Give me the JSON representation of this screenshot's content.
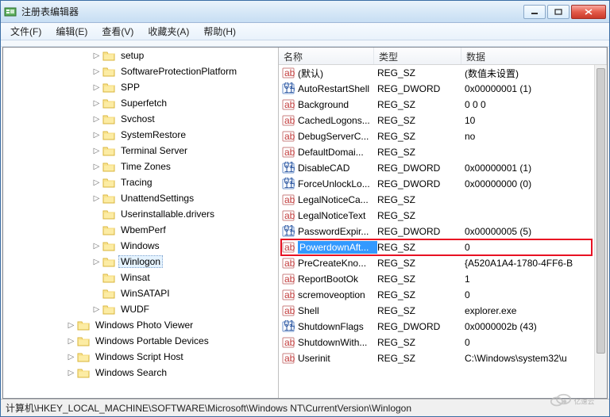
{
  "window": {
    "title": "注册表编辑器"
  },
  "menu": {
    "file": "文件(F)",
    "edit": "编辑(E)",
    "view": "查看(V)",
    "favorites": "收藏夹(A)",
    "help": "帮助(H)"
  },
  "columns": {
    "name": "名称",
    "type": "类型",
    "data": "数据"
  },
  "tree": [
    {
      "indent": 7,
      "label": "setup",
      "expand": "▷"
    },
    {
      "indent": 7,
      "label": "SoftwareProtectionPlatform",
      "expand": "▷"
    },
    {
      "indent": 7,
      "label": "SPP",
      "expand": "▷"
    },
    {
      "indent": 7,
      "label": "Superfetch",
      "expand": "▷"
    },
    {
      "indent": 7,
      "label": "Svchost",
      "expand": "▷"
    },
    {
      "indent": 7,
      "label": "SystemRestore",
      "expand": "▷"
    },
    {
      "indent": 7,
      "label": "Terminal Server",
      "expand": "▷"
    },
    {
      "indent": 7,
      "label": "Time Zones",
      "expand": "▷"
    },
    {
      "indent": 7,
      "label": "Tracing",
      "expand": "▷"
    },
    {
      "indent": 7,
      "label": "UnattendSettings",
      "expand": "▷"
    },
    {
      "indent": 7,
      "label": "Userinstallable.drivers",
      "expand": ""
    },
    {
      "indent": 7,
      "label": "WbemPerf",
      "expand": ""
    },
    {
      "indent": 7,
      "label": "Windows",
      "expand": "▷"
    },
    {
      "indent": 7,
      "label": "Winlogon",
      "expand": "▷",
      "selected": true
    },
    {
      "indent": 7,
      "label": "Winsat",
      "expand": ""
    },
    {
      "indent": 7,
      "label": "WinSATAPI",
      "expand": ""
    },
    {
      "indent": 7,
      "label": "WUDF",
      "expand": "▷"
    },
    {
      "indent": 5,
      "label": "Windows Photo Viewer",
      "expand": "▷"
    },
    {
      "indent": 5,
      "label": "Windows Portable Devices",
      "expand": "▷"
    },
    {
      "indent": 5,
      "label": "Windows Script Host",
      "expand": "▷"
    },
    {
      "indent": 5,
      "label": "Windows Search",
      "expand": "▷"
    }
  ],
  "values": [
    {
      "icon": "ab",
      "name": "(默认)",
      "type": "REG_SZ",
      "data": "(数值未设置)"
    },
    {
      "icon": "dw",
      "name": "AutoRestartShell",
      "type": "REG_DWORD",
      "data": "0x00000001 (1)"
    },
    {
      "icon": "ab",
      "name": "Background",
      "type": "REG_SZ",
      "data": "0 0 0"
    },
    {
      "icon": "ab",
      "name": "CachedLogons...",
      "type": "REG_SZ",
      "data": "10"
    },
    {
      "icon": "ab",
      "name": "DebugServerC...",
      "type": "REG_SZ",
      "data": "no"
    },
    {
      "icon": "ab",
      "name": "DefaultDomai...",
      "type": "REG_SZ",
      "data": ""
    },
    {
      "icon": "dw",
      "name": "DisableCAD",
      "type": "REG_DWORD",
      "data": "0x00000001 (1)"
    },
    {
      "icon": "dw",
      "name": "ForceUnlockLo...",
      "type": "REG_DWORD",
      "data": "0x00000000 (0)"
    },
    {
      "icon": "ab",
      "name": "LegalNoticeCa...",
      "type": "REG_SZ",
      "data": ""
    },
    {
      "icon": "ab",
      "name": "LegalNoticeText",
      "type": "REG_SZ",
      "data": ""
    },
    {
      "icon": "dw",
      "name": "PasswordExpir...",
      "type": "REG_DWORD",
      "data": "0x00000005 (5)"
    },
    {
      "icon": "ab",
      "name": "PowerdownAft...",
      "type": "REG_SZ",
      "data": "0",
      "selected": true
    },
    {
      "icon": "ab",
      "name": "PreCreateKno...",
      "type": "REG_SZ",
      "data": "{A520A1A4-1780-4FF6-B"
    },
    {
      "icon": "ab",
      "name": "ReportBootOk",
      "type": "REG_SZ",
      "data": "1"
    },
    {
      "icon": "ab",
      "name": "scremoveoption",
      "type": "REG_SZ",
      "data": "0"
    },
    {
      "icon": "ab",
      "name": "Shell",
      "type": "REG_SZ",
      "data": "explorer.exe"
    },
    {
      "icon": "dw",
      "name": "ShutdownFlags",
      "type": "REG_DWORD",
      "data": "0x0000002b (43)"
    },
    {
      "icon": "ab",
      "name": "ShutdownWith...",
      "type": "REG_SZ",
      "data": "0"
    },
    {
      "icon": "ab",
      "name": "Userinit",
      "type": "REG_SZ",
      "data": "C:\\Windows\\system32\\u"
    }
  ],
  "statusbar": "计算机\\HKEY_LOCAL_MACHINE\\SOFTWARE\\Microsoft\\Windows NT\\CurrentVersion\\Winlogon",
  "watermark": "亿速云",
  "highlight_row_index": 11
}
